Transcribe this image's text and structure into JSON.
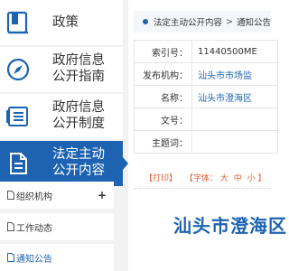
{
  "sidebar": {
    "nav": [
      {
        "label": "政策",
        "icon": "book-icon"
      },
      {
        "label": "政府信息\n公开指南",
        "icon": "compass-icon"
      },
      {
        "label": "政府信息\n公开制度",
        "icon": "document-list-icon"
      },
      {
        "label": "法定主动\n公开内容",
        "icon": "document-icon",
        "active": true
      }
    ],
    "sub": [
      {
        "label": "组织机构",
        "expand": "+"
      },
      {
        "label": "工作动态"
      },
      {
        "label": "通知公告"
      }
    ]
  },
  "breadcrumb": {
    "sep": ">",
    "items": [
      "法定主动公开内容",
      "通知公告"
    ]
  },
  "meta": {
    "rows": [
      {
        "key": "索引号：",
        "value": "11440500ME"
      },
      {
        "key": "发布机构：",
        "value": "汕头市市场监"
      },
      {
        "key": "名称：",
        "value": "汕头市澄海区"
      },
      {
        "key": "文号：",
        "value": ""
      },
      {
        "key": "主题词：",
        "value": ""
      }
    ]
  },
  "tools": {
    "print": "【打印】",
    "font_label": "【字体：",
    "large": "大",
    "medium": "中",
    "small": "小",
    "close": "】"
  },
  "article": {
    "title": "汕头市澄海区"
  },
  "colors": {
    "accent": "#1d63b2",
    "tool_text": "#e0623b"
  }
}
